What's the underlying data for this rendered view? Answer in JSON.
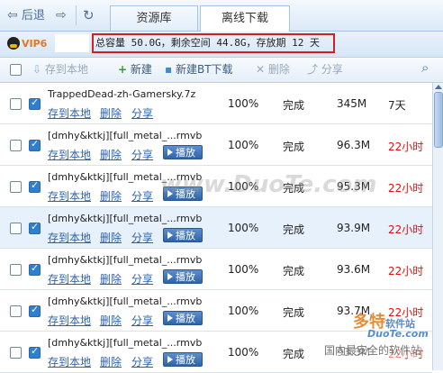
{
  "nav": {
    "back_label": "后退",
    "tabs": [
      {
        "label": "资源库",
        "active": false
      },
      {
        "label": "离线下载",
        "active": true
      }
    ]
  },
  "account": {
    "vip_label": "VIP6",
    "capacity_text": "总容量 50.0G，剩余空间 44.8G，存放期 12 天"
  },
  "toolbar": {
    "save_local": "存到本地",
    "new": "新建",
    "new_bt": "新建BT下载",
    "delete": "删除",
    "share": "分享"
  },
  "actions": {
    "save_local": "存到本地",
    "delete": "删除",
    "share": "分享",
    "play": "播放"
  },
  "rows": [
    {
      "name": "TrappedDead-zh-Gamersky.7z",
      "progress": "100%",
      "status": "完成",
      "size": "345M",
      "expiry": "7天",
      "expiry_red": false,
      "has_play": false,
      "selected": false
    },
    {
      "name": "[dmhy&ktkj][full_metal_...rmvb",
      "progress": "100%",
      "status": "完成",
      "size": "96.3M",
      "expiry": "22小时",
      "expiry_red": true,
      "has_play": true,
      "selected": false
    },
    {
      "name": "[dmhy&ktkj][full_metal_...rmvb",
      "progress": "100%",
      "status": "完成",
      "size": "95.3M",
      "expiry": "22小时",
      "expiry_red": true,
      "has_play": true,
      "selected": false
    },
    {
      "name": "[dmhy&ktkj][full_metal_...rmvb",
      "progress": "100%",
      "status": "完成",
      "size": "93.9M",
      "expiry": "22小时",
      "expiry_red": true,
      "has_play": true,
      "selected": true
    },
    {
      "name": "[dmhy&ktkj][full_metal_...rmvb",
      "progress": "100%",
      "status": "完成",
      "size": "93.6M",
      "expiry": "22小时",
      "expiry_red": true,
      "has_play": true,
      "selected": false
    },
    {
      "name": "[dmhy&ktkj][full_metal_...rmvb",
      "progress": "100%",
      "status": "完成",
      "size": "93.7M",
      "expiry": "22小时",
      "expiry_red": true,
      "has_play": true,
      "selected": false
    },
    {
      "name": "[dmhy&ktkj][full_metal_...rmvb",
      "progress": "100%",
      "status": "完成",
      "size": "93.3M",
      "expiry": "22小时",
      "expiry_red": true,
      "has_play": true,
      "selected": false
    }
  ],
  "watermarks": {
    "center": "www.DuoTe.com",
    "logo_cn": "多特",
    "logo_sub": "软件站",
    "logo_url": "DuoTe.com",
    "bottom": "国内最安全的软件站"
  },
  "colors": {
    "accent": "#2f63a8",
    "highlight_box": "#d21f1f",
    "expiry_red": "#dd1111",
    "selected_row": "#e6f1fb"
  }
}
